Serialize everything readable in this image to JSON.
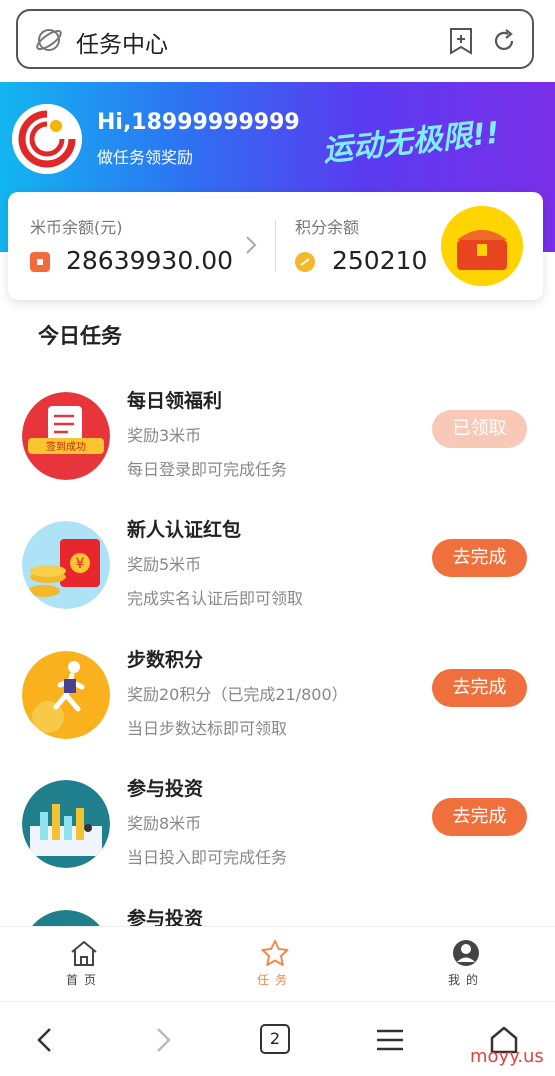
{
  "browser": {
    "page_title": "任务中心",
    "tab_count": "2",
    "watermark": "moyy.us"
  },
  "header": {
    "greeting": "Hi,18999999999",
    "subtitle": "做任务领奖励",
    "slogan": "运动无极限!!"
  },
  "balance": {
    "rice_label": "米币余额(元)",
    "rice_value": "28639930.00",
    "points_label": "积分余额",
    "points_value": "250210"
  },
  "tasks_title": "今日任务",
  "tasks": [
    {
      "name": "每日领福利",
      "reward": "奖励3米币",
      "desc": "每日登录即可完成任务",
      "button": "已领取",
      "badge": "签到成功"
    },
    {
      "name": "新人认证红包",
      "reward": "奖励5米币",
      "desc": "完成实名认证后即可领取",
      "button": "去完成"
    },
    {
      "name": "步数积分",
      "reward": "奖励20积分（已完成21/800）",
      "desc": "当日步数达标即可领取",
      "button": "去完成"
    },
    {
      "name": "参与投资",
      "reward": "奖励8米币",
      "desc": "当日投入即可完成任务",
      "button": "去完成"
    },
    {
      "name": "参与投资"
    }
  ],
  "tabbar": [
    {
      "label": "首页",
      "icon": "home-icon"
    },
    {
      "label": "任务",
      "icon": "star-icon"
    },
    {
      "label": "我的",
      "icon": "user-icon"
    }
  ],
  "colors": {
    "accent": "#ef6f3d",
    "accent_done": "#f8c9b7",
    "gradient_start": "#12b6f0",
    "gradient_end": "#7a2fe8"
  }
}
